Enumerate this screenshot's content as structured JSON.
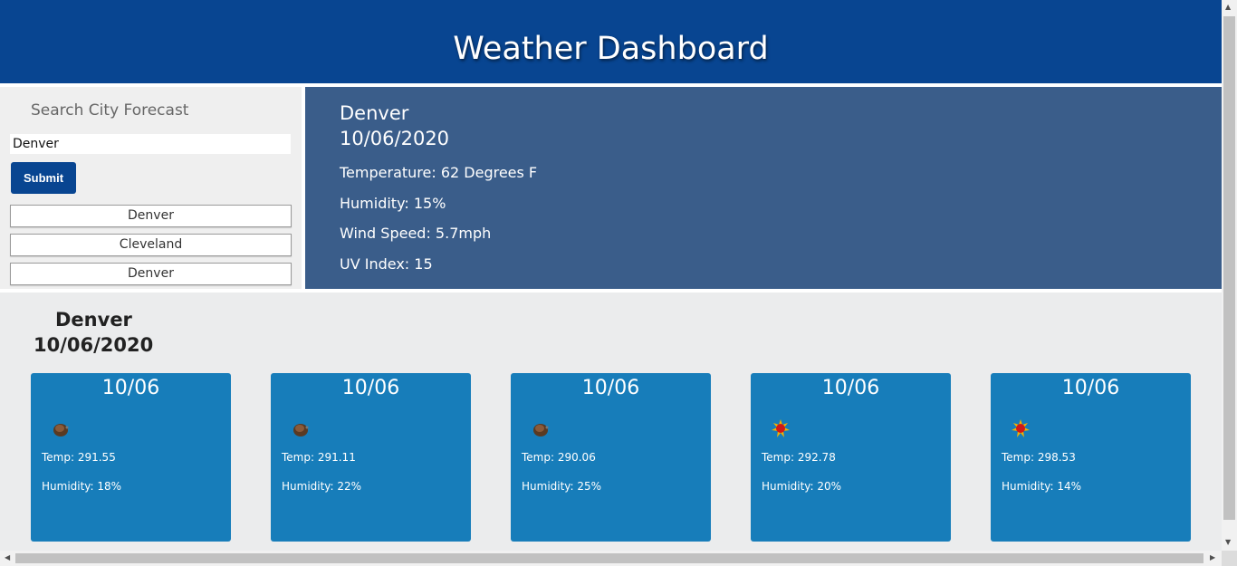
{
  "header": {
    "title": "Weather Dashboard"
  },
  "search": {
    "title": "Search City Forecast",
    "input_value": "Denver",
    "submit_label": "Submit",
    "history": [
      "Denver",
      "Cleveland",
      "Denver"
    ]
  },
  "current": {
    "city": "Denver",
    "date": "10/06/2020",
    "temperature": "Temperature: 62 Degrees F",
    "humidity": "Humidity: 15%",
    "wind": "Wind Speed: 5.7mph",
    "uv": "UV Index: 15"
  },
  "forecast": {
    "city": "Denver",
    "date": "10/06/2020",
    "cards": [
      {
        "date": "10/06",
        "icon": "cloud-icon",
        "temp": "Temp: 291.55",
        "humidity": "Humidity: 18%"
      },
      {
        "date": "10/06",
        "icon": "cloud-icon",
        "temp": "Temp: 291.11",
        "humidity": "Humidity: 22%"
      },
      {
        "date": "10/06",
        "icon": "cloud-icon",
        "temp": "Temp: 290.06",
        "humidity": "Humidity: 25%"
      },
      {
        "date": "10/06",
        "icon": "sun-icon",
        "temp": "Temp: 292.78",
        "humidity": "Humidity: 20%"
      },
      {
        "date": "10/06",
        "icon": "sun-icon",
        "temp": "Temp: 298.53",
        "humidity": "Humidity: 14%"
      }
    ]
  },
  "colors": {
    "header_bg": "#084591",
    "current_bg": "#3a5d8a",
    "card_bg": "#177dba",
    "forecast_bg": "#ebeced"
  }
}
